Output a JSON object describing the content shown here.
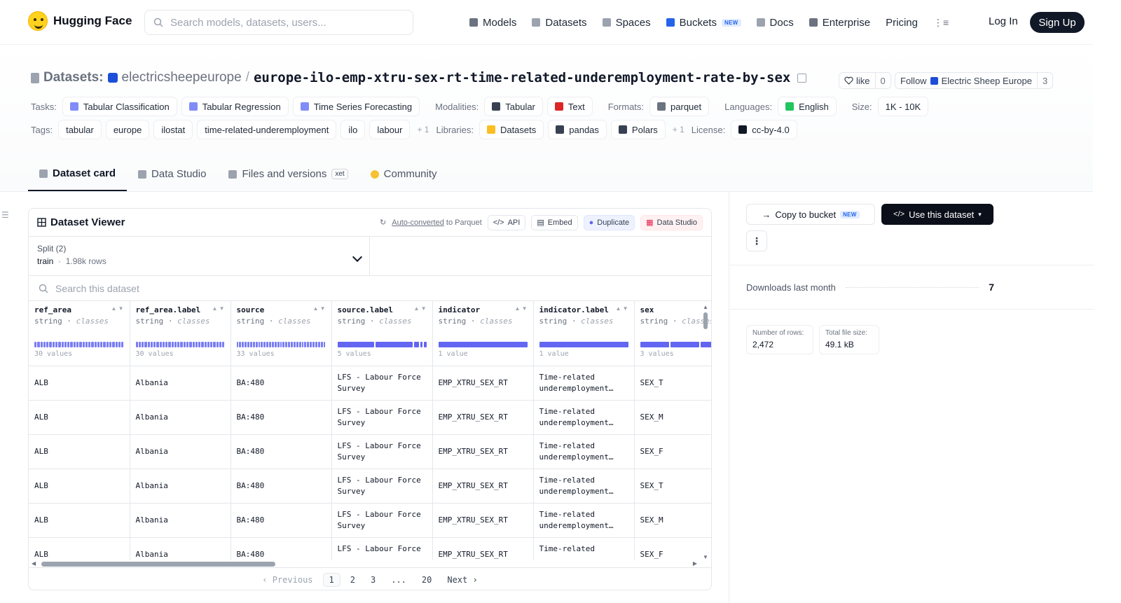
{
  "nav": {
    "brand": "Hugging Face",
    "search_placeholder": "Search models, datasets, users...",
    "items": [
      {
        "label": "Models",
        "icon": "cube-icon",
        "color": "#6b7280"
      },
      {
        "label": "Datasets",
        "icon": "database-icon",
        "color": "#9ca3af"
      },
      {
        "label": "Spaces",
        "icon": "grid-icon",
        "color": "#9ca3af"
      },
      {
        "label": "Buckets",
        "icon": "bucket-icon",
        "color": "#2563eb",
        "badge": "NEW"
      },
      {
        "label": "Docs",
        "icon": "book-icon",
        "color": "#9ca3af"
      },
      {
        "label": "Enterprise",
        "icon": "enterprise-icon",
        "color": "#6b7280"
      },
      {
        "label": "Pricing"
      }
    ],
    "login": "Log In",
    "signup": "Sign Up"
  },
  "header": {
    "prefix": "Datasets:",
    "org": "electricsheepeurope",
    "separator": "/",
    "name": "europe-ilo-emp-xtru-sex-rt-time-related-underemployment-rate-by-sex",
    "like_label": "like",
    "like_count": "0",
    "follow_label": "Follow",
    "follow_org": "Electric Sheep Europe",
    "follow_count": "3"
  },
  "meta": {
    "tasks_label": "Tasks:",
    "tasks": [
      "Tabular Classification",
      "Tabular Regression",
      "Time Series Forecasting"
    ],
    "modalities_label": "Modalities:",
    "modalities": [
      "Tabular",
      "Text"
    ],
    "formats_label": "Formats:",
    "formats": [
      "parquet"
    ],
    "languages_label": "Languages:",
    "languages": [
      "English"
    ],
    "size_label": "Size:",
    "size": "1K - 10K",
    "tags_label": "Tags:",
    "tags": [
      "tabular",
      "europe",
      "ilostat",
      "time-related-underemployment",
      "ilo",
      "labour"
    ],
    "tags_more": "+ 1",
    "libraries_label": "Libraries:",
    "libraries": [
      "Datasets",
      "pandas",
      "Polars"
    ],
    "libraries_more": "+ 1",
    "license_label": "License:",
    "license": "cc-by-4.0"
  },
  "tabs": [
    {
      "label": "Dataset card",
      "active": true
    },
    {
      "label": "Data Studio"
    },
    {
      "label": "Files and versions",
      "badge": "xet"
    },
    {
      "label": "Community"
    }
  ],
  "viewer": {
    "title": "Dataset Viewer",
    "auto_link": "Auto-converted",
    "auto_rest": "to Parquet",
    "api": "API",
    "embed": "Embed",
    "duplicate": "Duplicate",
    "data_studio": "Data Studio",
    "split_label": "Split (2)",
    "split_value": "train",
    "split_rows": "1.98k rows",
    "search_placeholder": "Search this dataset",
    "columns": [
      {
        "name": "ref_area",
        "type": "string",
        "kind": "classes",
        "values": "30 values",
        "segments": 30,
        "hist": "dense"
      },
      {
        "name": "ref_area.label",
        "type": "string",
        "kind": "classes",
        "values": "30 values",
        "segments": 30,
        "hist": "dense"
      },
      {
        "name": "source",
        "type": "string",
        "kind": "classes",
        "values": "33 values",
        "segments": 33,
        "hist": "dense"
      },
      {
        "name": "source.label",
        "type": "string",
        "kind": "classes",
        "values": "5 values",
        "segments": 5,
        "hist": "few"
      },
      {
        "name": "indicator",
        "type": "string",
        "kind": "classes",
        "values": "1 value",
        "segments": 1,
        "hist": "one"
      },
      {
        "name": "indicator.label",
        "type": "string",
        "kind": "classes",
        "values": "1 value",
        "segments": 1,
        "hist": "one"
      },
      {
        "name": "sex",
        "type": "string",
        "kind": "classes",
        "values": "3 values",
        "segments": 3,
        "hist": "few"
      }
    ],
    "rows": [
      [
        "ALB",
        "Albania",
        "BA:480",
        "LFS - Labour Force Survey",
        "EMP_XTRU_SEX_RT",
        "Time-related underemployment…",
        "SEX_T"
      ],
      [
        "ALB",
        "Albania",
        "BA:480",
        "LFS - Labour Force Survey",
        "EMP_XTRU_SEX_RT",
        "Time-related underemployment…",
        "SEX_M"
      ],
      [
        "ALB",
        "Albania",
        "BA:480",
        "LFS - Labour Force Survey",
        "EMP_XTRU_SEX_RT",
        "Time-related underemployment…",
        "SEX_F"
      ],
      [
        "ALB",
        "Albania",
        "BA:480",
        "LFS - Labour Force Survey",
        "EMP_XTRU_SEX_RT",
        "Time-related underemployment…",
        "SEX_T"
      ],
      [
        "ALB",
        "Albania",
        "BA:480",
        "LFS - Labour Force Survey",
        "EMP_XTRU_SEX_RT",
        "Time-related underemployment…",
        "SEX_M"
      ],
      [
        "ALB",
        "Albania",
        "BA:480",
        "LFS - Labour Force",
        "EMP_XTRU_SEX_RT",
        "Time-related",
        "SEX_F"
      ]
    ],
    "pager": {
      "prev": "Previous",
      "pages": [
        "1",
        "2",
        "3",
        "...",
        "20"
      ],
      "next": "Next"
    }
  },
  "sidebar": {
    "copy_bucket": "Copy to bucket",
    "copy_badge": "NEW",
    "use_dataset": "Use this dataset",
    "downloads_label": "Downloads last month",
    "downloads_value": "7",
    "rows_label": "Number of rows:",
    "rows_value": "2,472",
    "size_label": "Total file size:",
    "size_value": "49.1 kB"
  }
}
